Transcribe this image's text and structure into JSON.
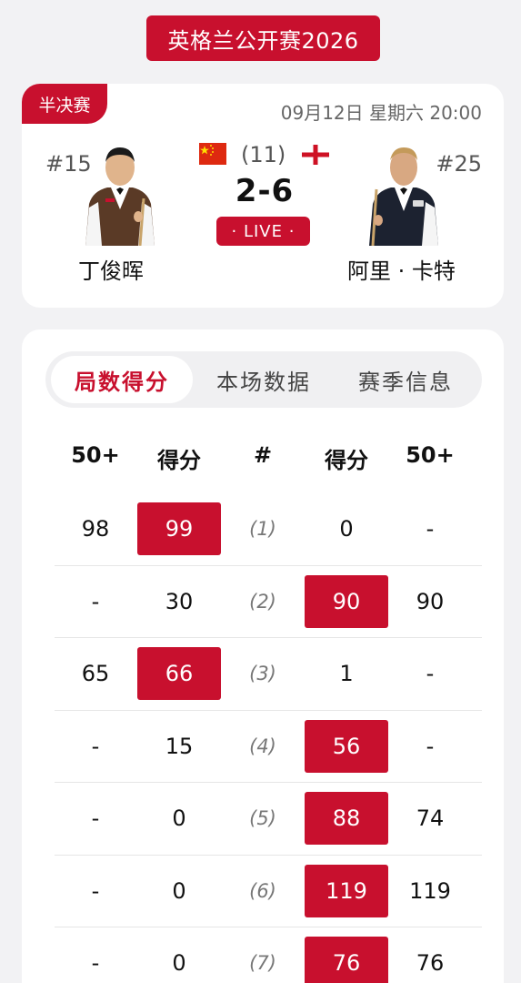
{
  "header": {
    "title": "英格兰公开赛2026"
  },
  "match": {
    "stage": "半决赛",
    "datetime": "09月12日 星期六 20:00",
    "frames_total": "(11)",
    "score": "2-6",
    "live_label": "· LIVE ·",
    "player1": {
      "rank": "#15",
      "name": "丁俊晖",
      "flag": "china-flag-icon"
    },
    "player2": {
      "rank": "#25",
      "name": "阿里 · 卡特",
      "flag": "england-flag-icon"
    }
  },
  "tabs": [
    {
      "label": "局数得分",
      "active": true
    },
    {
      "label": "本场数据",
      "active": false
    },
    {
      "label": "赛季信息",
      "active": false
    }
  ],
  "table": {
    "headers": [
      "50+",
      "得分",
      "#",
      "得分",
      "50+"
    ],
    "rows": [
      {
        "p1_break": "98",
        "p1_score": "99",
        "frame": "(1)",
        "p2_score": "0",
        "p2_break": "-",
        "winner": "p1"
      },
      {
        "p1_break": "-",
        "p1_score": "30",
        "frame": "(2)",
        "p2_score": "90",
        "p2_break": "90",
        "winner": "p2"
      },
      {
        "p1_break": "65",
        "p1_score": "66",
        "frame": "(3)",
        "p2_score": "1",
        "p2_break": "-",
        "winner": "p1"
      },
      {
        "p1_break": "-",
        "p1_score": "15",
        "frame": "(4)",
        "p2_score": "56",
        "p2_break": "-",
        "winner": "p2"
      },
      {
        "p1_break": "-",
        "p1_score": "0",
        "frame": "(5)",
        "p2_score": "88",
        "p2_break": "74",
        "winner": "p2"
      },
      {
        "p1_break": "-",
        "p1_score": "0",
        "frame": "(6)",
        "p2_score": "119",
        "p2_break": "119",
        "winner": "p2"
      },
      {
        "p1_break": "-",
        "p1_score": "0",
        "frame": "(7)",
        "p2_score": "76",
        "p2_break": "76",
        "winner": "p2"
      }
    ]
  },
  "colors": {
    "accent": "#c8102e",
    "background": "#f2f2f4",
    "card": "#ffffff"
  }
}
